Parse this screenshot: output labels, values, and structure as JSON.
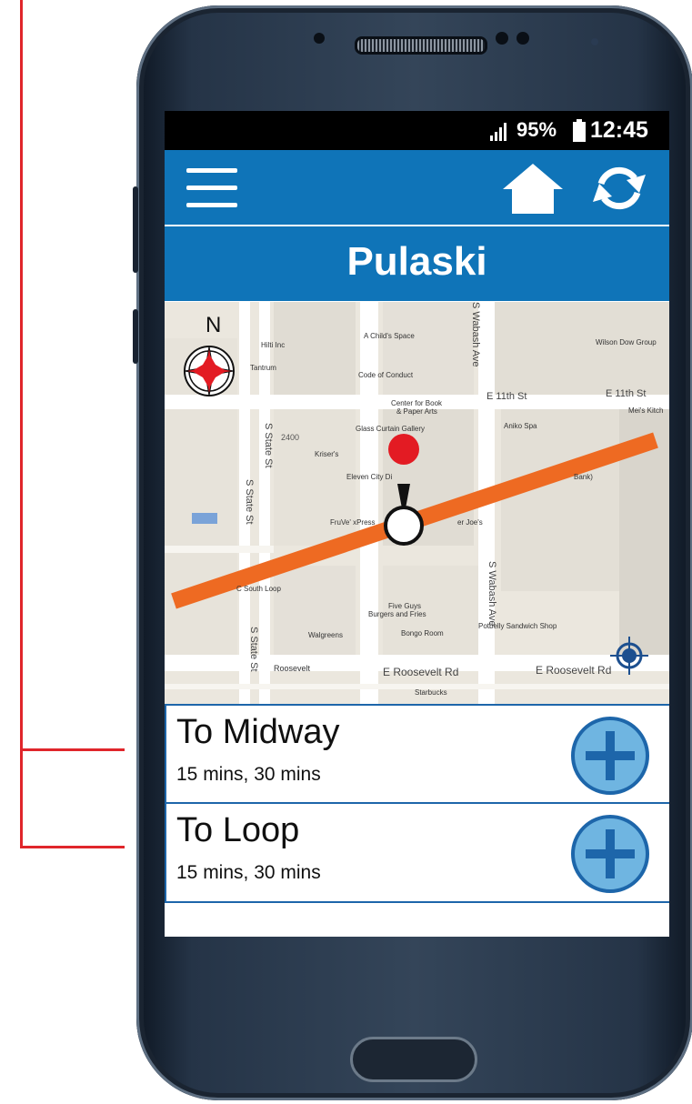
{
  "status_bar": {
    "battery": "95%",
    "time": "12:45"
  },
  "station": {
    "title": "Pulaski"
  },
  "map": {
    "compass_label": "N",
    "street_labels": [
      "E 11th St",
      "E 11th St",
      "S Wabash Ave",
      "S Wabash Ave",
      "S State St",
      "S State St",
      "S State St",
      "E Roosevelt Rd",
      "E Roosevelt Rd",
      "2400",
      "Roosevelt"
    ],
    "poi_labels": [
      "Hilti Inc",
      "A Child's Space",
      "Tantrum",
      "Code of Conduct",
      "Wilson Dow Group",
      "Center for Book",
      "& Paper Arts",
      "Glass Curtain Gallery",
      "Aniko Spa",
      "Mei's Kitch",
      "Kriser's",
      "Eleven City Di",
      "Bank)",
      "FruVe' xPress",
      "er Joe's",
      "C South Loop",
      "Five Guys",
      "Burgers and Fries",
      "Bongo Room",
      "Potbelly Sandwich Shop",
      "Walgreens",
      "Starbucks"
    ]
  },
  "routes": [
    {
      "title": "To Midway",
      "times": "15 mins, 30 mins"
    },
    {
      "title": "To Loop",
      "times": "15 mins, 30 mins"
    }
  ],
  "colors": {
    "header_blue": "#0f74b8",
    "route_line": "#ee6a22",
    "marker_red": "#e31b23",
    "plus_blue": "#6fb5e1",
    "annotation_red": "#e0262b"
  },
  "icons": [
    "menu-icon",
    "home-icon",
    "refresh-icon",
    "compass-icon",
    "locate-icon",
    "plus-circle-icon",
    "signal-icon",
    "battery-icon"
  ]
}
